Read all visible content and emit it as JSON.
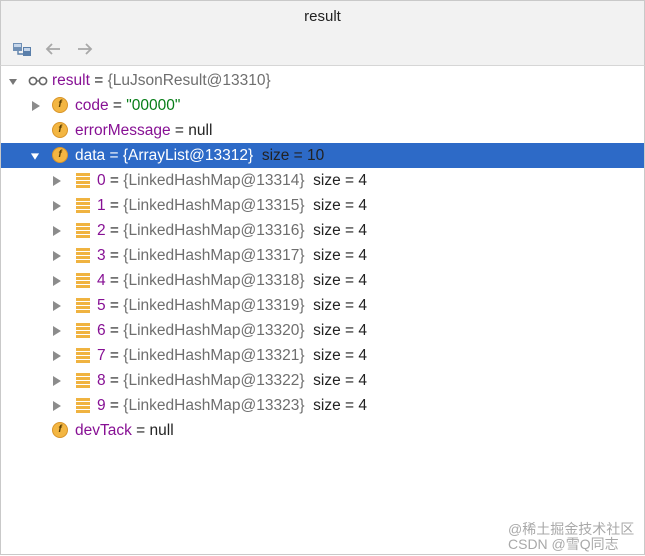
{
  "window": {
    "title": "result"
  },
  "toolbar": {
    "buttons": [
      {
        "icon": "evaluate-icon"
      },
      {
        "icon": "back-arrow-icon"
      },
      {
        "icon": "forward-arrow-icon"
      }
    ]
  },
  "tree": {
    "root": {
      "name": "result",
      "op": " = ",
      "value": "{LuJsonResult@13310}"
    },
    "code": {
      "name": "code",
      "op": " = ",
      "value": "\"00000\""
    },
    "errorMessage": {
      "name": "errorMessage",
      "op": " = ",
      "value": "null"
    },
    "data": {
      "name": "data",
      "op": " = ",
      "value": "{ArrayList@13312}",
      "size": "size = 10"
    },
    "items": [
      {
        "index": "0",
        "op": " = ",
        "value": "{LinkedHashMap@13314}",
        "size": "size = 4"
      },
      {
        "index": "1",
        "op": " = ",
        "value": "{LinkedHashMap@13315}",
        "size": "size = 4"
      },
      {
        "index": "2",
        "op": " = ",
        "value": "{LinkedHashMap@13316}",
        "size": "size = 4"
      },
      {
        "index": "3",
        "op": " = ",
        "value": "{LinkedHashMap@13317}",
        "size": "size = 4"
      },
      {
        "index": "4",
        "op": " = ",
        "value": "{LinkedHashMap@13318}",
        "size": "size = 4"
      },
      {
        "index": "5",
        "op": " = ",
        "value": "{LinkedHashMap@13319}",
        "size": "size = 4"
      },
      {
        "index": "6",
        "op": " = ",
        "value": "{LinkedHashMap@13320}",
        "size": "size = 4"
      },
      {
        "index": "7",
        "op": " = ",
        "value": "{LinkedHashMap@13321}",
        "size": "size = 4"
      },
      {
        "index": "8",
        "op": " = ",
        "value": "{LinkedHashMap@13322}",
        "size": "size = 4"
      },
      {
        "index": "9",
        "op": " = ",
        "value": "{LinkedHashMap@13323}",
        "size": "size = 4"
      }
    ],
    "devTack": {
      "name": "devTack",
      "op": " = ",
      "value": "null"
    },
    "field_icon_letter": "f"
  },
  "watermark": {
    "line1": "@稀土掘金技术社区",
    "line2": "CSDN @雪Q同志"
  },
  "colors": {
    "selection": "#2d6ac7",
    "field_name": "#871094",
    "string_value": "#067d17",
    "field_icon": "#f3b642"
  }
}
